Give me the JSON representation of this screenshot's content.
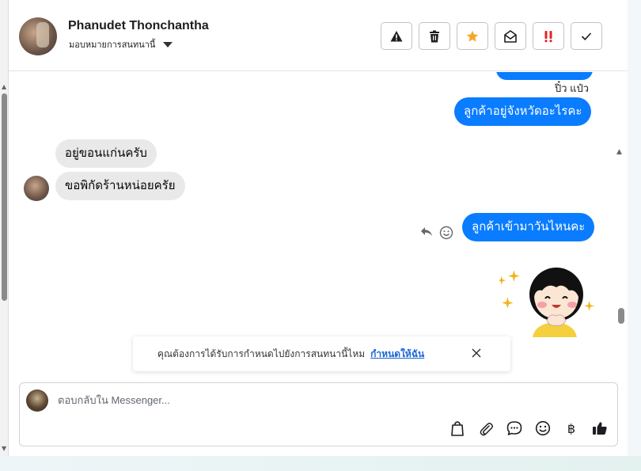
{
  "header": {
    "user_name": "Phanudet Thonchantha",
    "assign_label": "มอบหมายการสนทนานี้"
  },
  "toolbar": {
    "icons": [
      "warning-icon",
      "trash-icon",
      "star-icon",
      "open-envelope-icon",
      "double-exclamation-icon",
      "check-icon"
    ]
  },
  "thread": {
    "seen_label": "ปิ๋ว แป๋ว",
    "messages": [
      {
        "direction": "out",
        "text": "ลูกค้าอยู่จังหวัดอะไรคะ"
      },
      {
        "direction": "in",
        "text": "อยู่ขอนแก่นครับ"
      },
      {
        "direction": "in",
        "text": "ขอพิกัดร้านหน่อยครัย"
      },
      {
        "direction": "out",
        "text": "ลูกค้าเข้ามาวันไหนคะ"
      }
    ]
  },
  "toast": {
    "text": "คุณต้องการได้รับการกำหนดไปยังการสนทนานี้ไหม",
    "link": "กำหนดให้ฉัน"
  },
  "composer": {
    "placeholder": "ตอบกลับใน Messenger...",
    "baht_symbol": "฿",
    "icons": [
      "bag-icon",
      "paperclip-icon",
      "chat-bubble-icon",
      "emoji-icon",
      "baht-icon",
      "thumbs-up-icon"
    ]
  },
  "colors": {
    "outgoing_bubble": "#0a7cff",
    "incoming_bubble": "#e9e9ea",
    "link": "#1a66d3",
    "star": "#f5a623",
    "exclaim": "#e02424"
  }
}
